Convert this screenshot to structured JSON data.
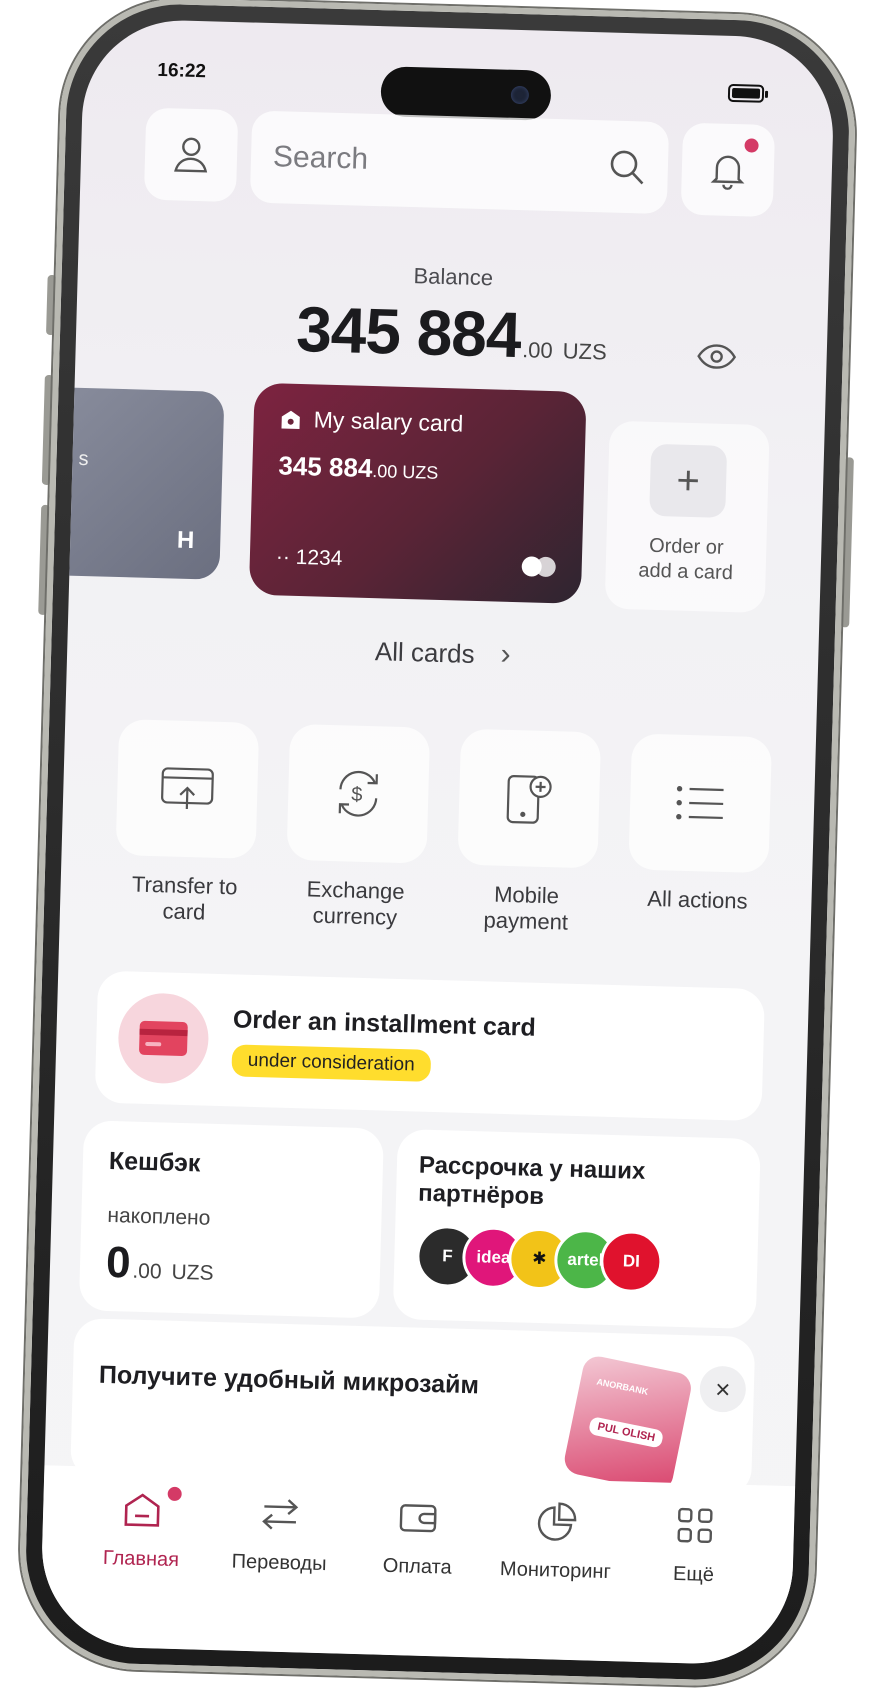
{
  "status": {
    "time": "16:22"
  },
  "search": {
    "placeholder": "Search"
  },
  "balance": {
    "label": "Balance",
    "integer": "345 884",
    "decimals": ".00",
    "currency": "UZS"
  },
  "cards": {
    "left_card": {
      "text": "s",
      "logo": "H"
    },
    "main_card": {
      "title": "My salary card",
      "amount_int": "345 884",
      "amount_dec": ".00 UZS",
      "number": "·· 1234"
    },
    "add_card": {
      "plus": "+",
      "label_1": "Order or",
      "label_2": "add a card"
    }
  },
  "all_cards": {
    "label": "All cards",
    "chevron": "›"
  },
  "actions": [
    {
      "line1": "Transfer to",
      "line2": "card",
      "icon": "transfer-to-card-icon"
    },
    {
      "line1": "Exchange",
      "line2": "currency",
      "icon": "exchange-currency-icon"
    },
    {
      "line1": "Mobile",
      "line2": "payment",
      "icon": "mobile-payment-icon"
    },
    {
      "line1": "All actions",
      "line2": "",
      "icon": "list-icon"
    }
  ],
  "installment": {
    "title": "Order an installment card",
    "badge": "under consideration"
  },
  "cashback": {
    "title": "Кешбэк",
    "sub": "накоплено",
    "integer": "0",
    "decimals": ".00",
    "currency": "UZS"
  },
  "partners": {
    "title_1": "Рассрочка у наших",
    "title_2": "партнёров",
    "logos": [
      {
        "text": "F",
        "color": "#2b2b2b"
      },
      {
        "text": "idea",
        "color": "#e0167a"
      },
      {
        "text": "✱",
        "color": "#f2c318"
      },
      {
        "text": "artel",
        "color": "#4cb648"
      },
      {
        "text": "DI",
        "color": "#e0122d"
      }
    ]
  },
  "promo": {
    "text": "Получите удобный микрозайм",
    "brand": "ANORBANK",
    "button": "PUL OLISH",
    "close": "×"
  },
  "tabbar": [
    {
      "label": "Главная",
      "active": true
    },
    {
      "label": "Переводы",
      "active": false
    },
    {
      "label": "Оплата",
      "active": false
    },
    {
      "label": "Мониторинг",
      "active": false
    },
    {
      "label": "Ещё",
      "active": false
    }
  ],
  "colors": {
    "accent": "#b02450",
    "card_start": "#7d2340",
    "card_end": "#2e2530",
    "badge": "#ffdd2d",
    "dot": "#d43a66"
  }
}
